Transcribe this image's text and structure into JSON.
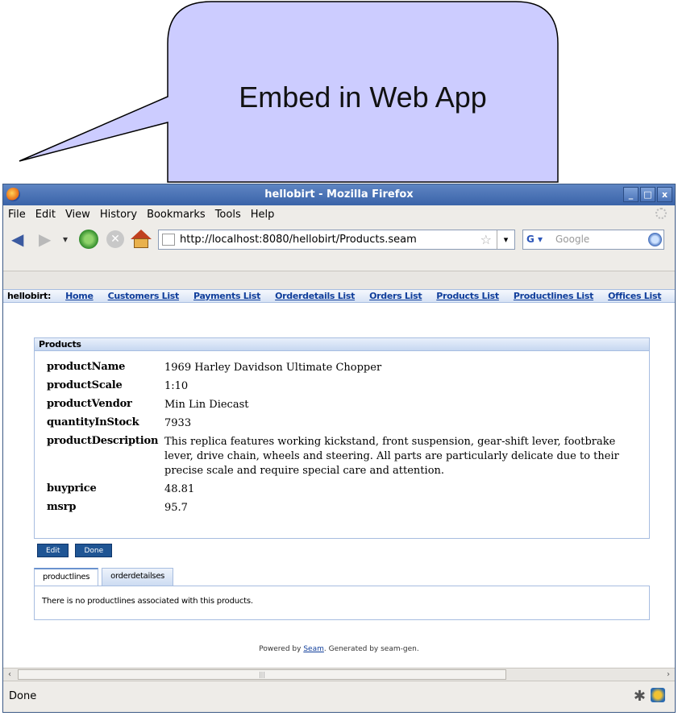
{
  "callout": {
    "text": "Embed in Web App"
  },
  "window": {
    "title": "hellobirt - Mozilla Firefox",
    "controls": [
      "_",
      "□",
      "x"
    ]
  },
  "menubar": {
    "items": [
      "File",
      "Edit",
      "View",
      "History",
      "Bookmarks",
      "Tools",
      "Help"
    ]
  },
  "toolbar": {
    "url": "http://localhost:8080/hellobirt/Products.seam",
    "search_placeholder": "Google",
    "search_engine": "G"
  },
  "app": {
    "brand": "hellobirt:",
    "nav": [
      "Home",
      "Customers List",
      "Payments List",
      "Orderdetails List",
      "Orders List",
      "Products List",
      "Productlines List",
      "Offices List"
    ]
  },
  "products": {
    "header": "Products",
    "properties": [
      {
        "name": "productName",
        "value": "1969 Harley Davidson Ultimate Chopper"
      },
      {
        "name": "productScale",
        "value": "1:10"
      },
      {
        "name": "productVendor",
        "value": "Min Lin Diecast"
      },
      {
        "name": "quantityInStock",
        "value": "7933"
      },
      {
        "name": "productDescription",
        "value": "This replica features working kickstand, front suspension, gear-shift lever, footbrake lever, drive chain, wheels and steering. All parts are particularly delicate due to their precise scale and require special care and attention."
      },
      {
        "name": "buyprice",
        "value": "48.81"
      },
      {
        "name": "msrp",
        "value": "95.7"
      }
    ]
  },
  "buttons": {
    "edit": "Edit",
    "done": "Done"
  },
  "tabs": {
    "items": [
      "productlines",
      "orderdetailses"
    ],
    "active": "productlines",
    "content": "There is no productlines associated with this products."
  },
  "footer": {
    "prefix": "Powered by ",
    "link": "Seam",
    "suffix": ". Generated by seam-gen."
  },
  "status": {
    "text": "Done"
  }
}
